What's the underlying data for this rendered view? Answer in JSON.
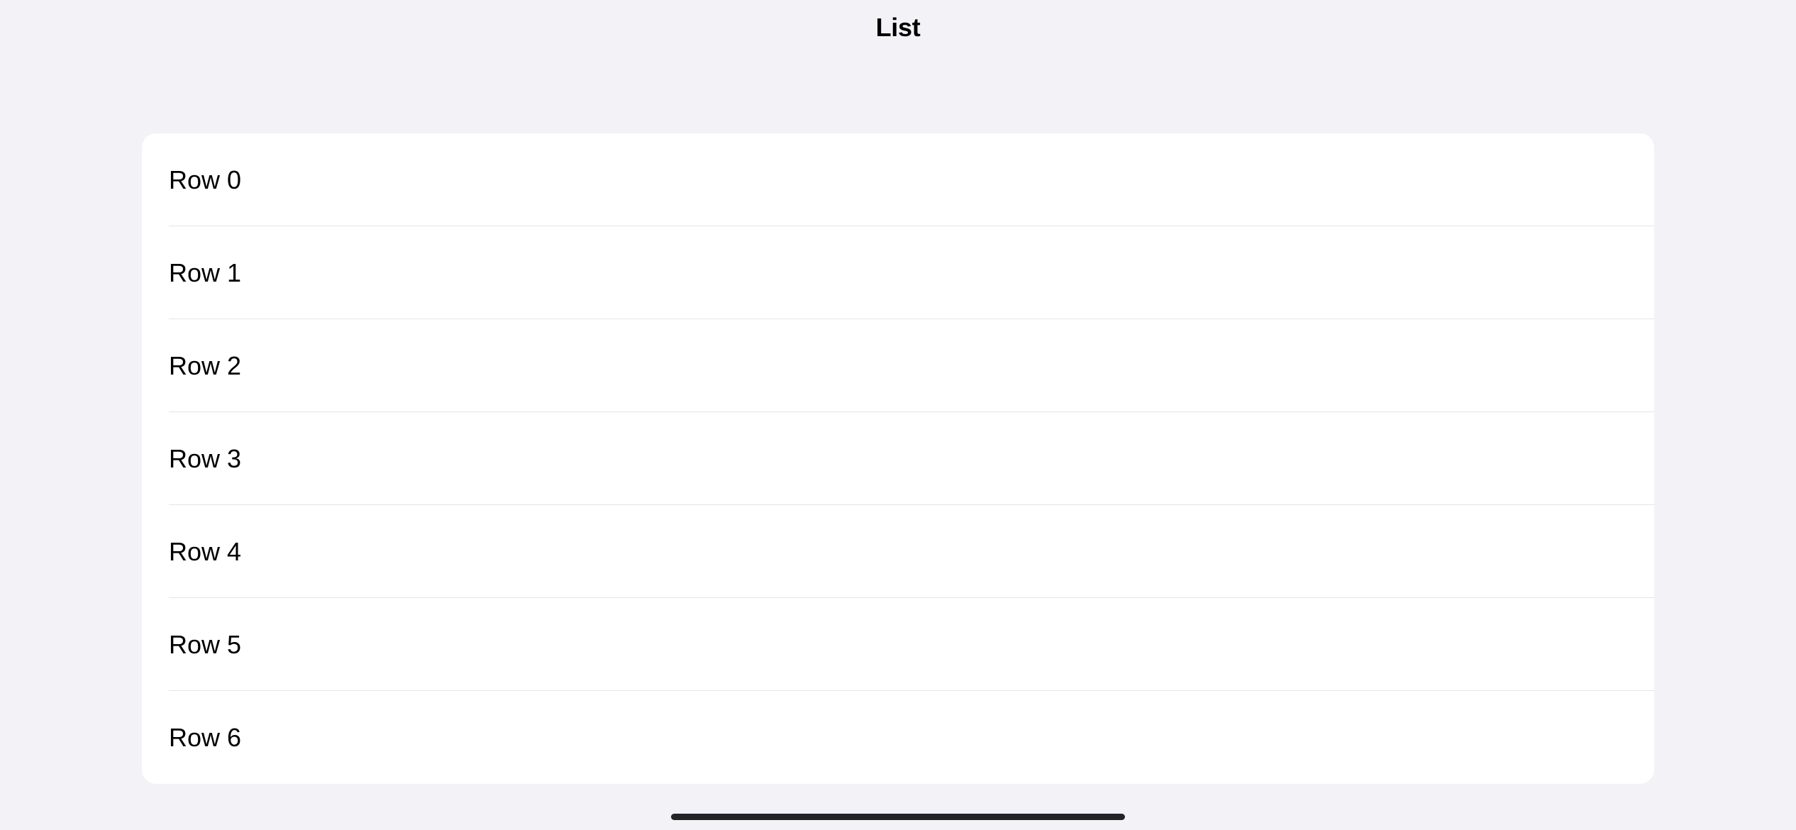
{
  "nav": {
    "title": "List"
  },
  "list": {
    "rows": [
      {
        "label": "Row 0"
      },
      {
        "label": "Row 1"
      },
      {
        "label": "Row 2"
      },
      {
        "label": "Row 3"
      },
      {
        "label": "Row 4"
      },
      {
        "label": "Row 5"
      },
      {
        "label": "Row 6"
      }
    ]
  }
}
